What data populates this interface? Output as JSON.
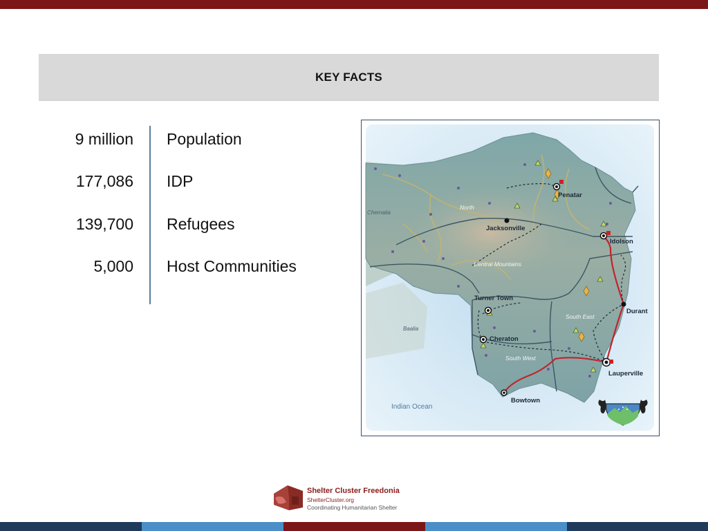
{
  "banner": {
    "title": "KEY FACTS"
  },
  "key_facts": [
    {
      "value": "9 million",
      "label": "Population"
    },
    {
      "value": "177,086",
      "label": "IDP"
    },
    {
      "value": "139,700",
      "label": "Refugees"
    },
    {
      "value": "5,000",
      "label": "Host Communities"
    }
  ],
  "map": {
    "cities": [
      "Penatar",
      "Jacksonville",
      "Idolson",
      "Turner Town",
      "Durant",
      "Cheraton",
      "Lauperville",
      "Bowtown"
    ],
    "regions": [
      "North",
      "Central Mountains",
      "South East",
      "South West"
    ],
    "neighbors": [
      "Chemalia",
      "Baalia"
    ],
    "sea": "Indian Ocean"
  },
  "footer": {
    "org_name": "Shelter Cluster Freedonia",
    "website": "ShelterCluster.org",
    "tagline": "Coordinating Humanitarian Shelter"
  },
  "colors": {
    "top_bar": "#7b1716",
    "bottom_bar": [
      "#1f3a5a",
      "#4a8fc7",
      "#7b1716",
      "#4a8fc7",
      "#1f3a5a"
    ],
    "road": "#c0242b",
    "river": "#c9b46a"
  }
}
